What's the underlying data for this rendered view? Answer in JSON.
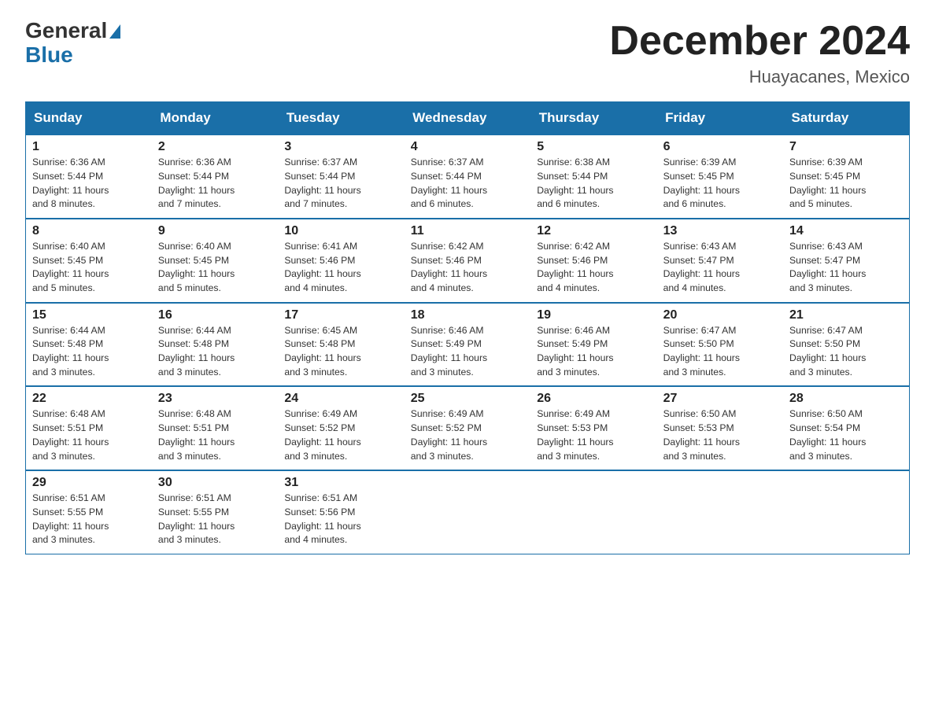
{
  "header": {
    "logo_general": "General",
    "logo_blue": "Blue",
    "month_title": "December 2024",
    "location": "Huayacanes, Mexico"
  },
  "days_of_week": [
    "Sunday",
    "Monday",
    "Tuesday",
    "Wednesday",
    "Thursday",
    "Friday",
    "Saturday"
  ],
  "weeks": [
    [
      {
        "day": "1",
        "sunrise": "6:36 AM",
        "sunset": "5:44 PM",
        "daylight": "11 hours and 8 minutes."
      },
      {
        "day": "2",
        "sunrise": "6:36 AM",
        "sunset": "5:44 PM",
        "daylight": "11 hours and 7 minutes."
      },
      {
        "day": "3",
        "sunrise": "6:37 AM",
        "sunset": "5:44 PM",
        "daylight": "11 hours and 7 minutes."
      },
      {
        "day": "4",
        "sunrise": "6:37 AM",
        "sunset": "5:44 PM",
        "daylight": "11 hours and 6 minutes."
      },
      {
        "day": "5",
        "sunrise": "6:38 AM",
        "sunset": "5:44 PM",
        "daylight": "11 hours and 6 minutes."
      },
      {
        "day": "6",
        "sunrise": "6:39 AM",
        "sunset": "5:45 PM",
        "daylight": "11 hours and 6 minutes."
      },
      {
        "day": "7",
        "sunrise": "6:39 AM",
        "sunset": "5:45 PM",
        "daylight": "11 hours and 5 minutes."
      }
    ],
    [
      {
        "day": "8",
        "sunrise": "6:40 AM",
        "sunset": "5:45 PM",
        "daylight": "11 hours and 5 minutes."
      },
      {
        "day": "9",
        "sunrise": "6:40 AM",
        "sunset": "5:45 PM",
        "daylight": "11 hours and 5 minutes."
      },
      {
        "day": "10",
        "sunrise": "6:41 AM",
        "sunset": "5:46 PM",
        "daylight": "11 hours and 4 minutes."
      },
      {
        "day": "11",
        "sunrise": "6:42 AM",
        "sunset": "5:46 PM",
        "daylight": "11 hours and 4 minutes."
      },
      {
        "day": "12",
        "sunrise": "6:42 AM",
        "sunset": "5:46 PM",
        "daylight": "11 hours and 4 minutes."
      },
      {
        "day": "13",
        "sunrise": "6:43 AM",
        "sunset": "5:47 PM",
        "daylight": "11 hours and 4 minutes."
      },
      {
        "day": "14",
        "sunrise": "6:43 AM",
        "sunset": "5:47 PM",
        "daylight": "11 hours and 3 minutes."
      }
    ],
    [
      {
        "day": "15",
        "sunrise": "6:44 AM",
        "sunset": "5:48 PM",
        "daylight": "11 hours and 3 minutes."
      },
      {
        "day": "16",
        "sunrise": "6:44 AM",
        "sunset": "5:48 PM",
        "daylight": "11 hours and 3 minutes."
      },
      {
        "day": "17",
        "sunrise": "6:45 AM",
        "sunset": "5:48 PM",
        "daylight": "11 hours and 3 minutes."
      },
      {
        "day": "18",
        "sunrise": "6:46 AM",
        "sunset": "5:49 PM",
        "daylight": "11 hours and 3 minutes."
      },
      {
        "day": "19",
        "sunrise": "6:46 AM",
        "sunset": "5:49 PM",
        "daylight": "11 hours and 3 minutes."
      },
      {
        "day": "20",
        "sunrise": "6:47 AM",
        "sunset": "5:50 PM",
        "daylight": "11 hours and 3 minutes."
      },
      {
        "day": "21",
        "sunrise": "6:47 AM",
        "sunset": "5:50 PM",
        "daylight": "11 hours and 3 minutes."
      }
    ],
    [
      {
        "day": "22",
        "sunrise": "6:48 AM",
        "sunset": "5:51 PM",
        "daylight": "11 hours and 3 minutes."
      },
      {
        "day": "23",
        "sunrise": "6:48 AM",
        "sunset": "5:51 PM",
        "daylight": "11 hours and 3 minutes."
      },
      {
        "day": "24",
        "sunrise": "6:49 AM",
        "sunset": "5:52 PM",
        "daylight": "11 hours and 3 minutes."
      },
      {
        "day": "25",
        "sunrise": "6:49 AM",
        "sunset": "5:52 PM",
        "daylight": "11 hours and 3 minutes."
      },
      {
        "day": "26",
        "sunrise": "6:49 AM",
        "sunset": "5:53 PM",
        "daylight": "11 hours and 3 minutes."
      },
      {
        "day": "27",
        "sunrise": "6:50 AM",
        "sunset": "5:53 PM",
        "daylight": "11 hours and 3 minutes."
      },
      {
        "day": "28",
        "sunrise": "6:50 AM",
        "sunset": "5:54 PM",
        "daylight": "11 hours and 3 minutes."
      }
    ],
    [
      {
        "day": "29",
        "sunrise": "6:51 AM",
        "sunset": "5:55 PM",
        "daylight": "11 hours and 3 minutes."
      },
      {
        "day": "30",
        "sunrise": "6:51 AM",
        "sunset": "5:55 PM",
        "daylight": "11 hours and 3 minutes."
      },
      {
        "day": "31",
        "sunrise": "6:51 AM",
        "sunset": "5:56 PM",
        "daylight": "11 hours and 4 minutes."
      },
      null,
      null,
      null,
      null
    ]
  ],
  "labels": {
    "sunrise": "Sunrise:",
    "sunset": "Sunset:",
    "daylight": "Daylight:"
  }
}
